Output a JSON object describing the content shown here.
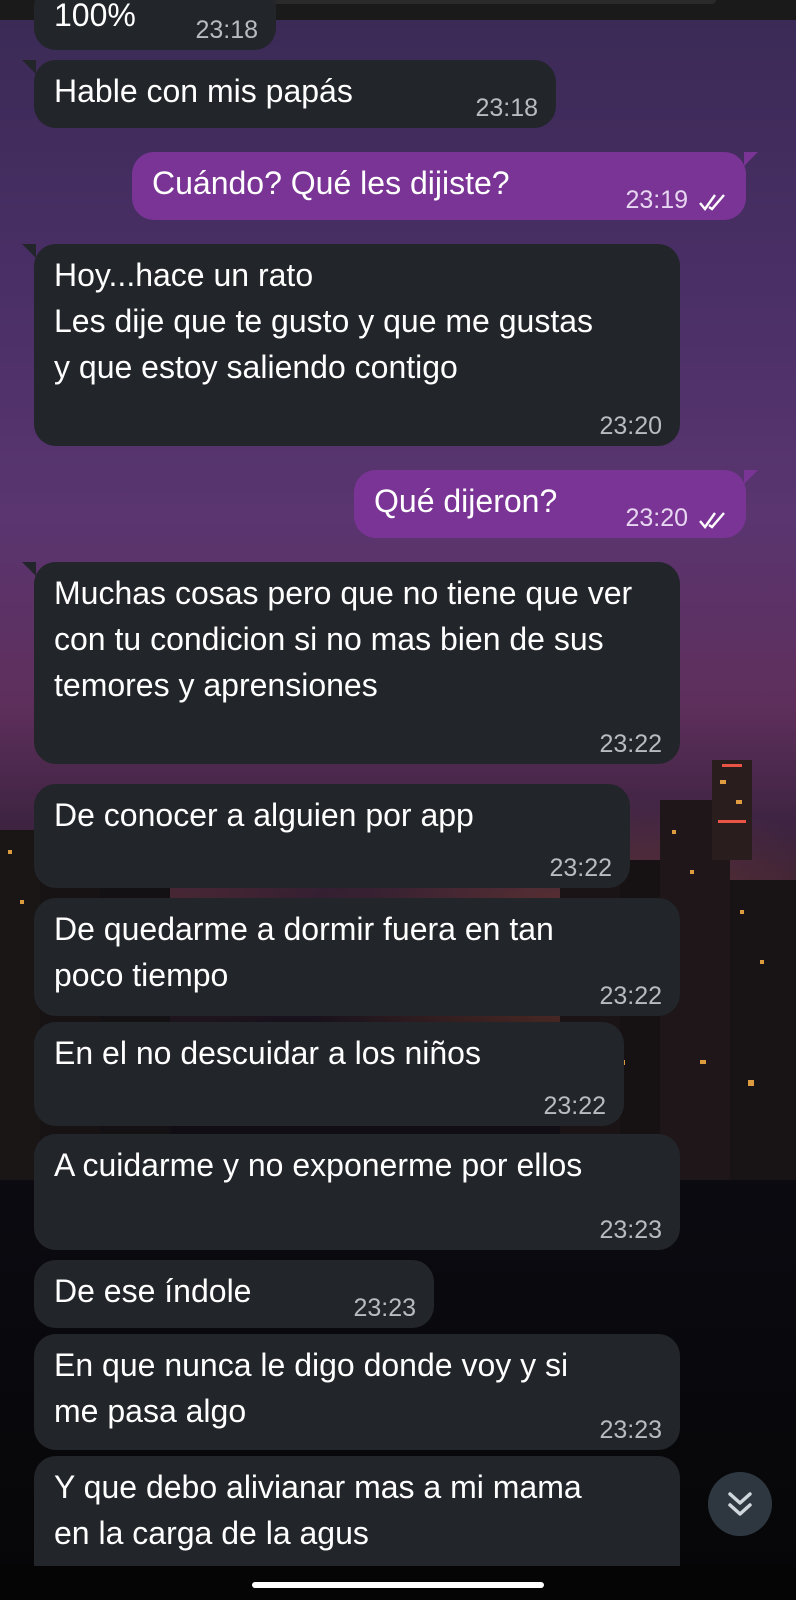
{
  "colors": {
    "incoming_bubble": "#222529",
    "outgoing_bubble": "#7a3495",
    "timestamp": "#b7bcc2"
  },
  "messages": [
    {
      "text": "100%",
      "time": "23:18",
      "dir": "in"
    },
    {
      "text": "Hable con mis papás",
      "time": "23:18",
      "dir": "in"
    },
    {
      "text": "Cuándo? Qué les dijiste?",
      "time": "23:19",
      "dir": "out",
      "status": "read"
    },
    {
      "text": "Hoy...hace un rato\nLes dije que te gusto y que me gustas y que estoy saliendo contigo",
      "time": "23:20",
      "dir": "in"
    },
    {
      "text": "Qué dijeron?",
      "time": "23:20",
      "dir": "out",
      "status": "read"
    },
    {
      "text": "Muchas cosas  pero que  no tiene  que ver con tu condicion si no mas bien de sus temores y aprensiones",
      "time": "23:22",
      "dir": "in"
    },
    {
      "text": "De conocer  a alguien por app",
      "time": "23:22",
      "dir": "in"
    },
    {
      "text": "De quedarme a dormir fuera en tan poco tiempo",
      "time": "23:22",
      "dir": "in"
    },
    {
      "text": "En el no descuidar a los niños",
      "time": "23:22",
      "dir": "in"
    },
    {
      "text": "A cuidarme y no exponerme por ellos",
      "time": "23:23",
      "dir": "in"
    },
    {
      "text": "De ese índole",
      "time": "23:23",
      "dir": "in"
    },
    {
      "text": "En que nunca le digo donde voy y si me pasa algo",
      "time": "23:23",
      "dir": "in"
    },
    {
      "text": "Y que debo alivianar mas a mi mama en la carga de la agus",
      "time": "",
      "dir": "in"
    }
  ],
  "icons": {
    "read_receipt": "double-check-icon",
    "scroll_down": "chevron-double-down-icon"
  }
}
